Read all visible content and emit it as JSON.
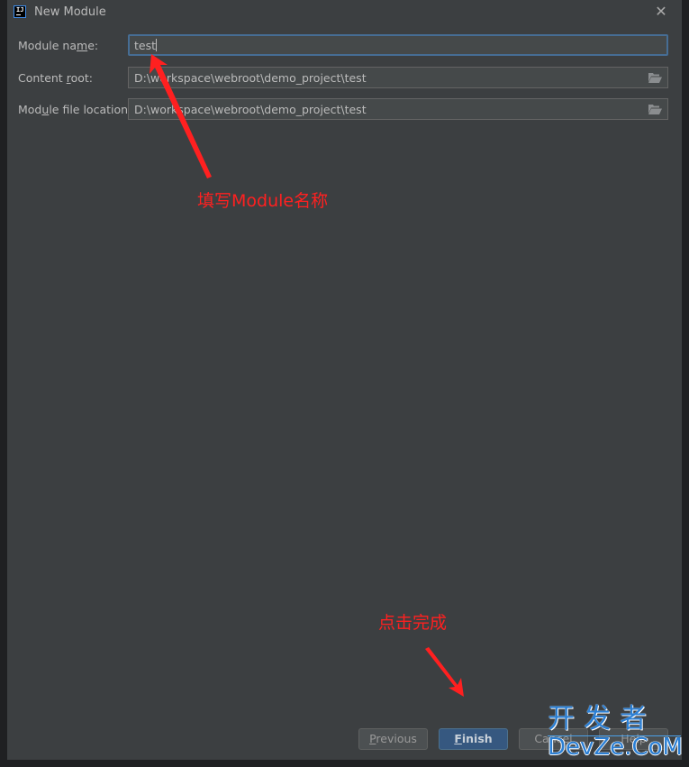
{
  "window": {
    "app_icon": "intellij-icon",
    "app_icon_text": "IJ",
    "title": "New Module",
    "close_icon": "close-icon"
  },
  "form": {
    "module_name": {
      "label_before": "Module na",
      "label_mnemonic": "m",
      "label_after": "e:",
      "value": "test"
    },
    "content_root": {
      "label_before": "Content ",
      "label_mnemonic": "r",
      "label_after": "oot:",
      "value": "D:\\workspace\\webroot\\demo_project\\test",
      "browse_icon": "folder-open-icon"
    },
    "module_file_location": {
      "label_before": "Mod",
      "label_mnemonic": "u",
      "label_after": "le file location:",
      "value": "D:\\workspace\\webroot\\demo_project\\test",
      "browse_icon": "folder-open-icon"
    }
  },
  "annotations": {
    "fill_module_name": "填写Module名称",
    "click_finish": "点击完成",
    "color": "#ff2020"
  },
  "buttons": {
    "previous": {
      "mnemonic": "P",
      "rest": "revious"
    },
    "finish": {
      "mnemonic": "F",
      "rest": "inish"
    },
    "cancel": "Cancel",
    "help": "Help"
  },
  "watermark": {
    "top": "开发者",
    "bottom": "DevZe.CoM"
  },
  "colors": {
    "dialog_bg": "#3c3f41",
    "field_bg": "#45494a",
    "focus_border": "#466d94",
    "primary_button": "#365880",
    "watermark": "#2b7fd4"
  }
}
